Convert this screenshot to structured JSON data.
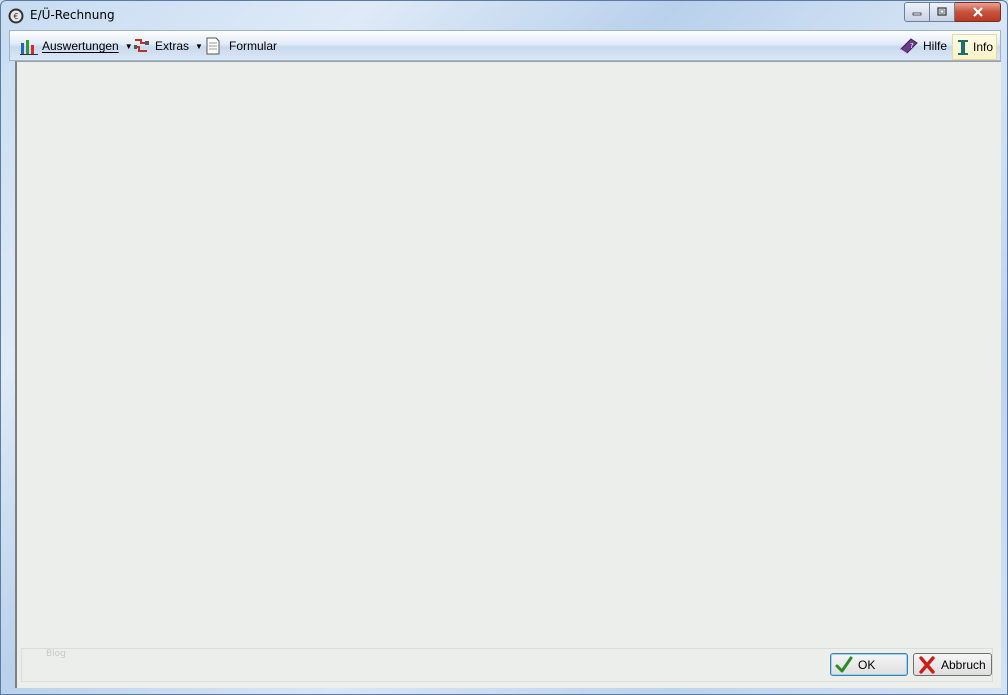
{
  "window": {
    "title": "E/Ü-Rechnung"
  },
  "toolbar": {
    "auswertungen": "Auswertungen",
    "extras": "Extras",
    "formular": "Formular",
    "hilfe": "Hilfe",
    "info": "Info"
  },
  "footer": {
    "watermark": "Blog",
    "ok": "OK",
    "cancel": "Abbruch"
  },
  "icons": {
    "app": "app-icon",
    "auswertungen": "bar-chart-icon",
    "extras": "tools-icon",
    "formular": "document-icon",
    "hilfe": "help-book-icon",
    "info": "info-icon",
    "ok": "checkmark-icon",
    "cancel": "red-x-icon"
  }
}
